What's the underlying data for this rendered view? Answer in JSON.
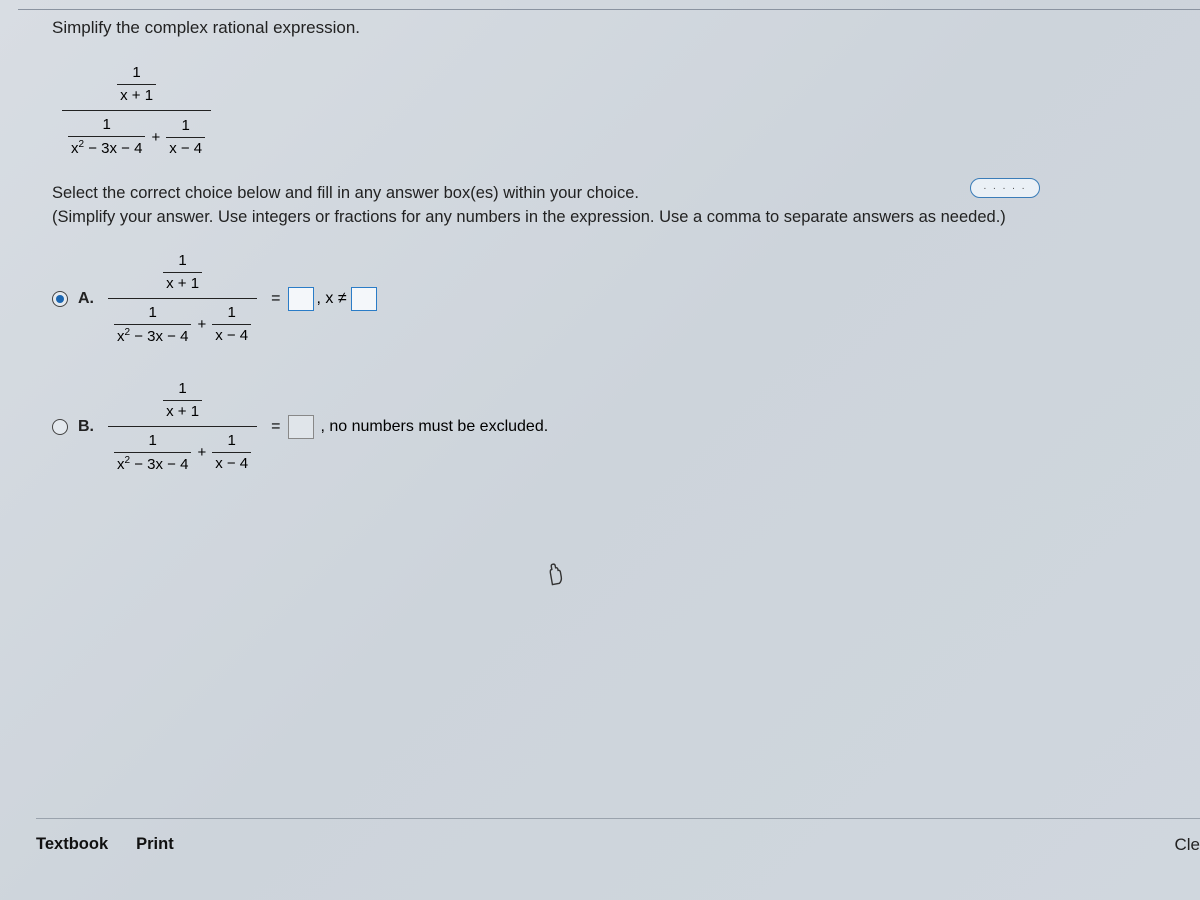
{
  "question": {
    "prompt": "Simplify the complex rational expression.",
    "numerator_top": "1",
    "numerator_bottom": "x + 1",
    "denom_left_top": "1",
    "denom_left_bottom_a": "x",
    "denom_left_bottom_exp": "2",
    "denom_left_bottom_rest": " − 3x − 4",
    "plus": "+",
    "denom_right_top": "1",
    "denom_right_bottom": "x − 4"
  },
  "hint_dots": ". . . . .",
  "instructions": {
    "line1": "Select the correct choice below and fill in any answer box(es) within your choice.",
    "line2": "(Simplify your answer. Use integers or fractions for any numbers in the expression. Use a comma to separate answers as needed.)"
  },
  "choices": {
    "a": {
      "label": "A.",
      "equals": "=",
      "comma_xneq": ", x ≠"
    },
    "b": {
      "label": "B.",
      "equals": "=",
      "tail": ", no numbers must be excluded."
    }
  },
  "footer": {
    "textbook": "Textbook",
    "print": "Print",
    "clear": "Cle"
  }
}
